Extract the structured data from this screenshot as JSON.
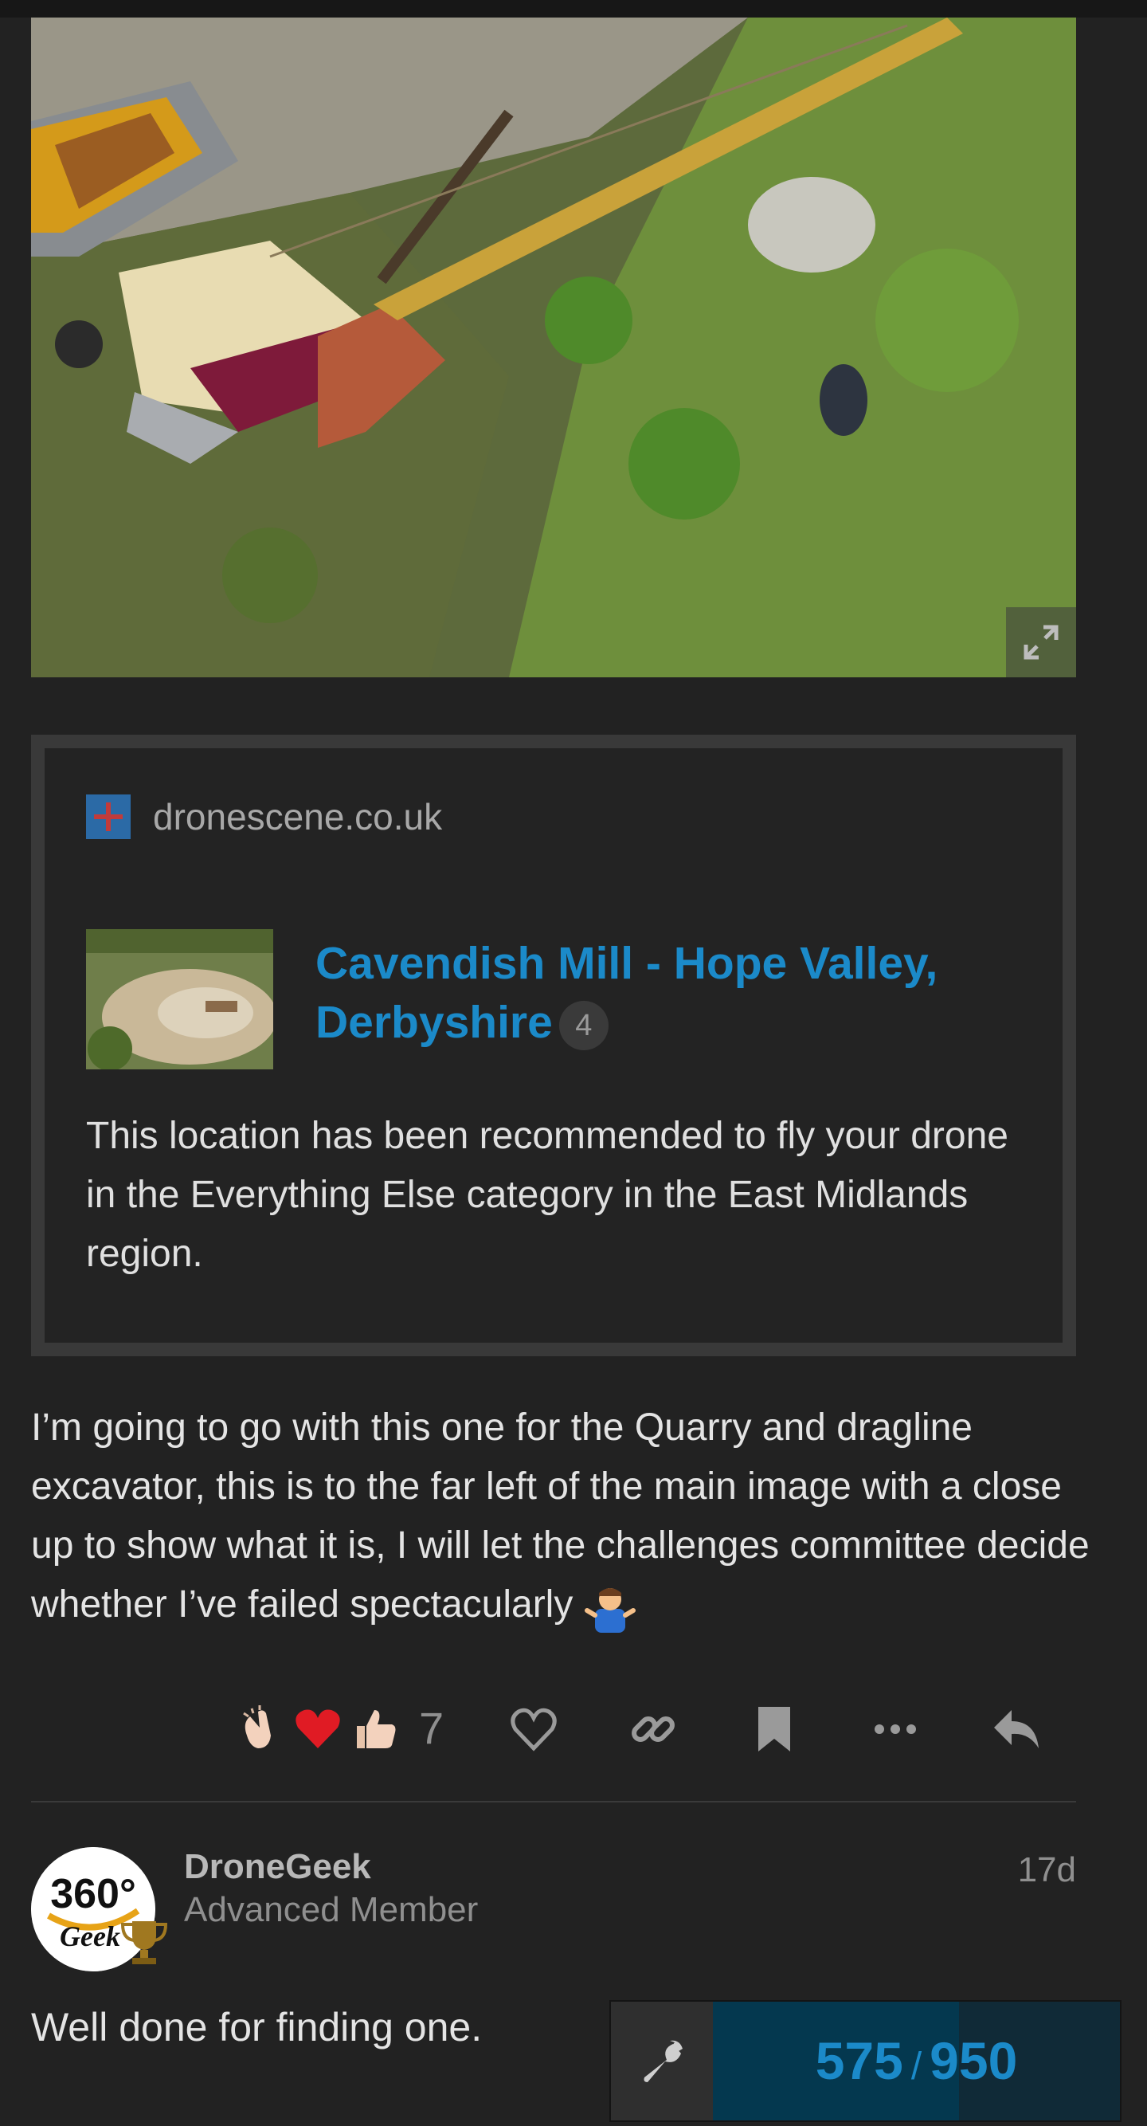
{
  "onebox": {
    "source": "dronescene.co.uk",
    "title": "Cavendish Mill - Hope Valley, Derbyshire",
    "count": "4",
    "description": "This location has been recommended to fly your drone in the Everything Else category in the East Midlands region."
  },
  "post": {
    "text": "I’m going to go with this one for the Quarry and dragline excavator, this is to the far left of the main image with a close up to show what it is, I will let the challenges committee decide whether I’ve failed spectacularly"
  },
  "actions": {
    "reactions": [
      "clapping-hands",
      "red-heart",
      "thumbs-up"
    ],
    "reaction_count": "7",
    "icons": [
      "heart-icon",
      "link-icon",
      "bookmark-icon",
      "more-icon",
      "reply-icon"
    ]
  },
  "reply": {
    "username": "DroneGeek",
    "user_title": "Advanced Member",
    "time": "17d",
    "text": "Well done for finding one.",
    "avatar": {
      "top": "360°",
      "bottom": "Geek"
    }
  },
  "progress": {
    "current": "575",
    "total": "950",
    "fraction": 0.605
  }
}
